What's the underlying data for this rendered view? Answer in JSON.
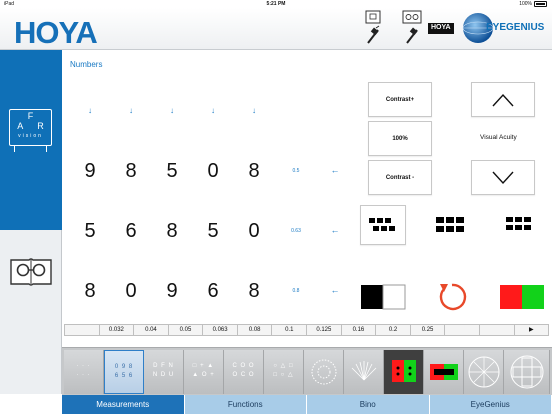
{
  "status": {
    "carrier": "iPad",
    "time": "5:21 PM",
    "battery": "100%"
  },
  "header": {
    "brand": "HOYA",
    "eyegenius_small": "HOYA",
    "eyegenius": "EYEGENIUS"
  },
  "sidebar": {
    "far": {
      "letter_f": "F",
      "letters_ar": "A R",
      "vision": "vision"
    }
  },
  "main": {
    "title": "Numbers",
    "down_arrow": "↓",
    "row_arrow": "←",
    "rows": [
      {
        "digits": [
          "9",
          "8",
          "5",
          "0",
          "8"
        ],
        "acuity": "0.5"
      },
      {
        "digits": [
          "5",
          "6",
          "8",
          "5",
          "0"
        ],
        "acuity": "0.63"
      },
      {
        "digits": [
          "8",
          "0",
          "9",
          "6",
          "8"
        ],
        "acuity": "0.8"
      }
    ]
  },
  "controls": {
    "contrast_plus": "Contrast+",
    "contrast_value": "100%",
    "contrast_minus": "Contrast -",
    "visual_acuity": "Visual Acuity",
    "red_color": "#ff1a1a",
    "green_color": "#12d21a",
    "reset_color": "#e8492a"
  },
  "acuity_strip": [
    "",
    "0.032",
    "0.04",
    "0.05",
    "0.063",
    "0.08",
    "0.1",
    "0.125",
    "0.16",
    "0.2",
    "0.25",
    "",
    "",
    "▶"
  ],
  "toolbar": {
    "tools": [
      {
        "line1": "· · ·",
        "line2": "· · ·"
      },
      {
        "line1": "0 9 8",
        "line2": "6 5 6"
      },
      {
        "line1": "D F N",
        "line2": "N D U"
      },
      {
        "line1": "□ + ▲",
        "line2": "▲ O +"
      },
      {
        "line1": "C O O",
        "line2": "O C O"
      },
      {
        "line1": "○ △ □",
        "line2": "□ ○ △"
      }
    ]
  },
  "tabs": [
    {
      "label": "Measurements"
    },
    {
      "label": "Functions"
    },
    {
      "label": "Bino"
    },
    {
      "label": "EyeGenius"
    }
  ]
}
